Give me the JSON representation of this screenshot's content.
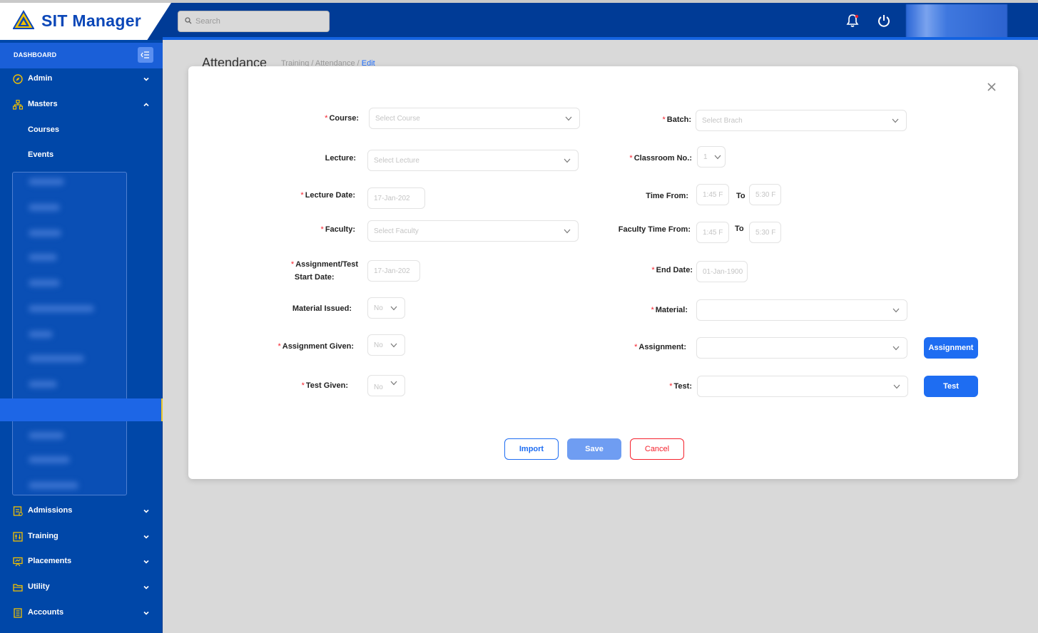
{
  "app": {
    "name": "SIT Manager"
  },
  "search": {
    "placeholder": "Search"
  },
  "sidebar": {
    "dashboard": "DASHBOARD",
    "admin": "Admin",
    "masters": "Masters",
    "courses": "Courses",
    "events": "Events",
    "admissions": "Admissions",
    "training": "Training",
    "placements": "Placements",
    "utility": "Utility",
    "accounts": "Accounts"
  },
  "page": {
    "title": "Attendance",
    "crumb1": "Training /",
    "crumb2": "Attendance /",
    "crumb3": "Edit"
  },
  "form": {
    "course": {
      "label": "Course:",
      "placeholder": "Select Course"
    },
    "batch": {
      "label": "Batch:",
      "placeholder": "Select Brach"
    },
    "lecture": {
      "label": "Lecture:",
      "placeholder": "Select Lecture"
    },
    "classroom": {
      "label": "Classroom No.:",
      "value": "1"
    },
    "lecture_date": {
      "label": "Lecture Date:",
      "value": "17-Jan-202"
    },
    "time_from": {
      "label": "Time From:",
      "from": "1:45 F",
      "to_label": "To",
      "to": "5:30 F"
    },
    "faculty": {
      "label": "Faculty:",
      "placeholder": "Select Faculty"
    },
    "faculty_time": {
      "label": "Faculty Time From:",
      "from": "1:45 F",
      "to_label": "To",
      "to": "5:30 F"
    },
    "assign_start": {
      "label_line1": "Assignment/Test",
      "label_line2": "Start Date:",
      "value": "17-Jan-202"
    },
    "end_date": {
      "label": "End Date:",
      "value": "01-Jan-1900"
    },
    "material_issued": {
      "label": "Material Issued:",
      "value": "No"
    },
    "material": {
      "label": "Material:"
    },
    "assignment_given": {
      "label": "Assignment Given:",
      "value": "No"
    },
    "assignment": {
      "label": "Assignment:",
      "button": "Assignment"
    },
    "test_given": {
      "label": "Test Given:",
      "value": "No"
    },
    "test": {
      "label": "Test:",
      "button": "Test"
    }
  },
  "actions": {
    "import": "Import",
    "save": "Save",
    "cancel": "Cancel"
  },
  "colors": {
    "primary": "#1e6df2",
    "header": "#003b96",
    "sidebar": "#0047a8",
    "danger": "#f5222d"
  }
}
